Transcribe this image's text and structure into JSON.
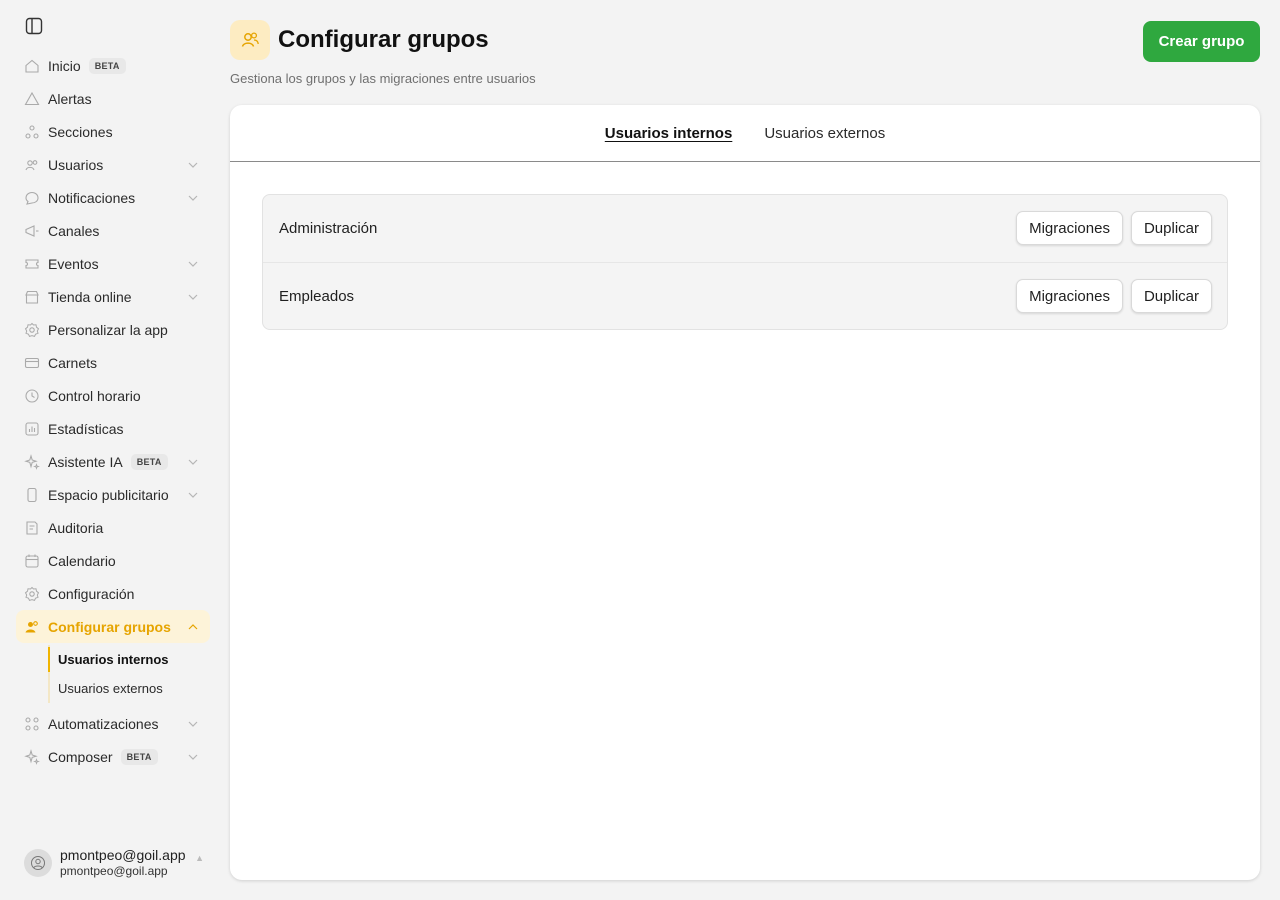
{
  "sidebar": {
    "items": [
      {
        "label": "Inicio",
        "icon": "home-icon",
        "badge": "BETA",
        "chevron": false
      },
      {
        "label": "Alertas",
        "icon": "alert-triangle-icon",
        "chevron": false
      },
      {
        "label": "Secciones",
        "icon": "sections-icon",
        "chevron": false
      },
      {
        "label": "Usuarios",
        "icon": "users-icon",
        "chevron": true
      },
      {
        "label": "Notificaciones",
        "icon": "chat-bubble-icon",
        "chevron": true
      },
      {
        "label": "Canales",
        "icon": "megaphone-icon",
        "chevron": false
      },
      {
        "label": "Eventos",
        "icon": "ticket-icon",
        "chevron": true
      },
      {
        "label": "Tienda online",
        "icon": "store-icon",
        "chevron": true
      },
      {
        "label": "Personalizar la app",
        "icon": "settings-gear-icon",
        "chevron": false
      },
      {
        "label": "Carnets",
        "icon": "card-icon",
        "chevron": false
      },
      {
        "label": "Control horario",
        "icon": "clock-icon",
        "chevron": false
      },
      {
        "label": "Estadísticas",
        "icon": "bar-chart-icon",
        "chevron": false
      },
      {
        "label": "Asistente IA",
        "icon": "sparkle-icon",
        "badge": "BETA",
        "chevron": true
      },
      {
        "label": "Espacio publicitario",
        "icon": "phone-icon",
        "chevron": true
      },
      {
        "label": "Auditoria",
        "icon": "audit-document-icon",
        "chevron": false
      },
      {
        "label": "Calendario",
        "icon": "calendar-icon",
        "chevron": false
      },
      {
        "label": "Configuración",
        "icon": "cog-icon",
        "chevron": false
      },
      {
        "label": "Configurar grupos",
        "icon": "group-icon",
        "chevron": true,
        "active": true,
        "expanded": true
      }
    ],
    "subitems": [
      {
        "label": "Usuarios internos",
        "active": true
      },
      {
        "label": "Usuarios externos",
        "active": false
      }
    ],
    "items_after": [
      {
        "label": "Automatizaciones",
        "icon": "automation-icon",
        "chevron": true
      },
      {
        "label": "Composer",
        "icon": "sparkle-icon",
        "badge": "BETA",
        "chevron": true
      }
    ],
    "user": {
      "name": "pmontpeo@goil.app",
      "email": "pmontpeo@goil.app"
    }
  },
  "header": {
    "title": "Configurar grupos",
    "subtitle": "Gestiona los grupos y las migraciones entre usuarios",
    "create_button": "Crear grupo"
  },
  "tabs": [
    {
      "label": "Usuarios internos",
      "active": true
    },
    {
      "label": "Usuarios externos",
      "active": false
    }
  ],
  "groups": [
    {
      "name": "Administración",
      "migrate_label": "Migraciones",
      "duplicate_label": "Duplicar"
    },
    {
      "name": "Empleados",
      "migrate_label": "Migraciones",
      "duplicate_label": "Duplicar"
    }
  ],
  "colors": {
    "accent": "#f0b400",
    "primary_button": "#2fa83f",
    "active_bg": "#fdf3d9"
  }
}
